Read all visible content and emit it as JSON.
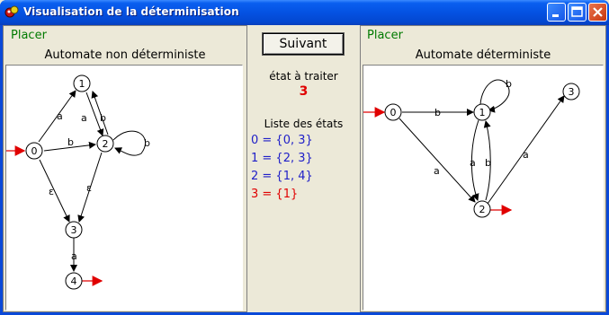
{
  "window": {
    "title": "Visualisation de la déterminisation",
    "minimize_label": "_",
    "maximize_label": "□",
    "close_label": "✕"
  },
  "left_panel": {
    "placer": "Placer",
    "title": "Automate non déterministe"
  },
  "right_panel": {
    "placer": "Placer",
    "title": "Automate déterministe"
  },
  "middle": {
    "next_button": "Suivant",
    "state_to_process_label": "état à traiter",
    "state_to_process_value": "3",
    "states_list_label": "Liste des états",
    "states": [
      {
        "text": "0 = {0, 3}",
        "color": "#2020c8"
      },
      {
        "text": "1 = {2, 3}",
        "color": "#2020c8"
      },
      {
        "text": "2 = {1, 4}",
        "color": "#2020c8"
      },
      {
        "text": "3 = {1}",
        "color": "#e00000"
      }
    ]
  },
  "nfa": {
    "states": [
      "0",
      "1",
      "2",
      "3",
      "4"
    ],
    "initial": "0",
    "final": [
      "2",
      "4"
    ],
    "transitions": [
      {
        "from": "0",
        "to": "1",
        "label": "a"
      },
      {
        "from": "0",
        "to": "2",
        "label": "b"
      },
      {
        "from": "1",
        "to": "2",
        "label": "a"
      },
      {
        "from": "2",
        "to": "1",
        "label": "b"
      },
      {
        "from": "2",
        "to": "2",
        "label": "b"
      },
      {
        "from": "0",
        "to": "3",
        "label": "ε"
      },
      {
        "from": "2",
        "to": "3",
        "label": "ε"
      },
      {
        "from": "3",
        "to": "4",
        "label": "a"
      }
    ]
  },
  "dfa": {
    "states": [
      "0",
      "1",
      "2",
      "3"
    ],
    "initial": "0",
    "final": [
      "2"
    ],
    "transitions": [
      {
        "from": "0",
        "to": "1",
        "label": "b"
      },
      {
        "from": "0",
        "to": "2",
        "label": "a"
      },
      {
        "from": "1",
        "to": "1",
        "label": "b"
      },
      {
        "from": "1",
        "to": "2",
        "label": "a"
      },
      {
        "from": "2",
        "to": "1",
        "label": "b"
      },
      {
        "from": "2",
        "to": "3",
        "label": "a"
      }
    ]
  },
  "colors": {
    "accent_green": "#007a00",
    "arrow_red": "#e00000",
    "state_blue": "#2020c8",
    "titlebar_blue": "#0452e2"
  }
}
